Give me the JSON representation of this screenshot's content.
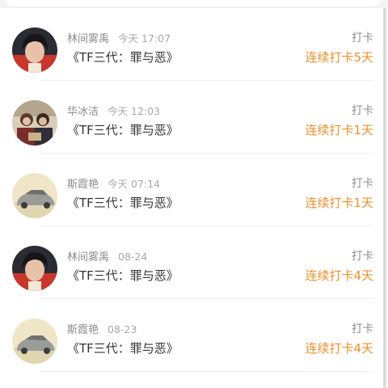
{
  "checkins": [
    {
      "name": "林间雾禹",
      "time": "今天 17:07",
      "book": "《TF三代：罪与恶》",
      "action": "打卡",
      "streak": "连续打卡5天",
      "avatar": "portrait-avatar"
    },
    {
      "name": "华冰洁",
      "time": "今天 12:03",
      "book": "《TF三代：罪与恶》",
      "action": "打卡",
      "streak": "连续打卡1天",
      "avatar": "group-photo-avatar"
    },
    {
      "name": "斯霞艳",
      "time": "今天 07:14",
      "book": "《TF三代：罪与恶》",
      "action": "打卡",
      "streak": "连续打卡1天",
      "avatar": "car-avatar"
    },
    {
      "name": "林间雾禹",
      "time": "08-24",
      "book": "《TF三代：罪与恶》",
      "action": "打卡",
      "streak": "连续打卡4天",
      "avatar": "portrait-avatar"
    },
    {
      "name": "斯霞艳",
      "time": "08-23",
      "book": "《TF三代：罪与恶》",
      "action": "打卡",
      "streak": "连续打卡4天",
      "avatar": "car-avatar"
    }
  ],
  "colors": {
    "streak": "#f0902c",
    "meta": "#8c8c8c",
    "text": "#333333"
  }
}
